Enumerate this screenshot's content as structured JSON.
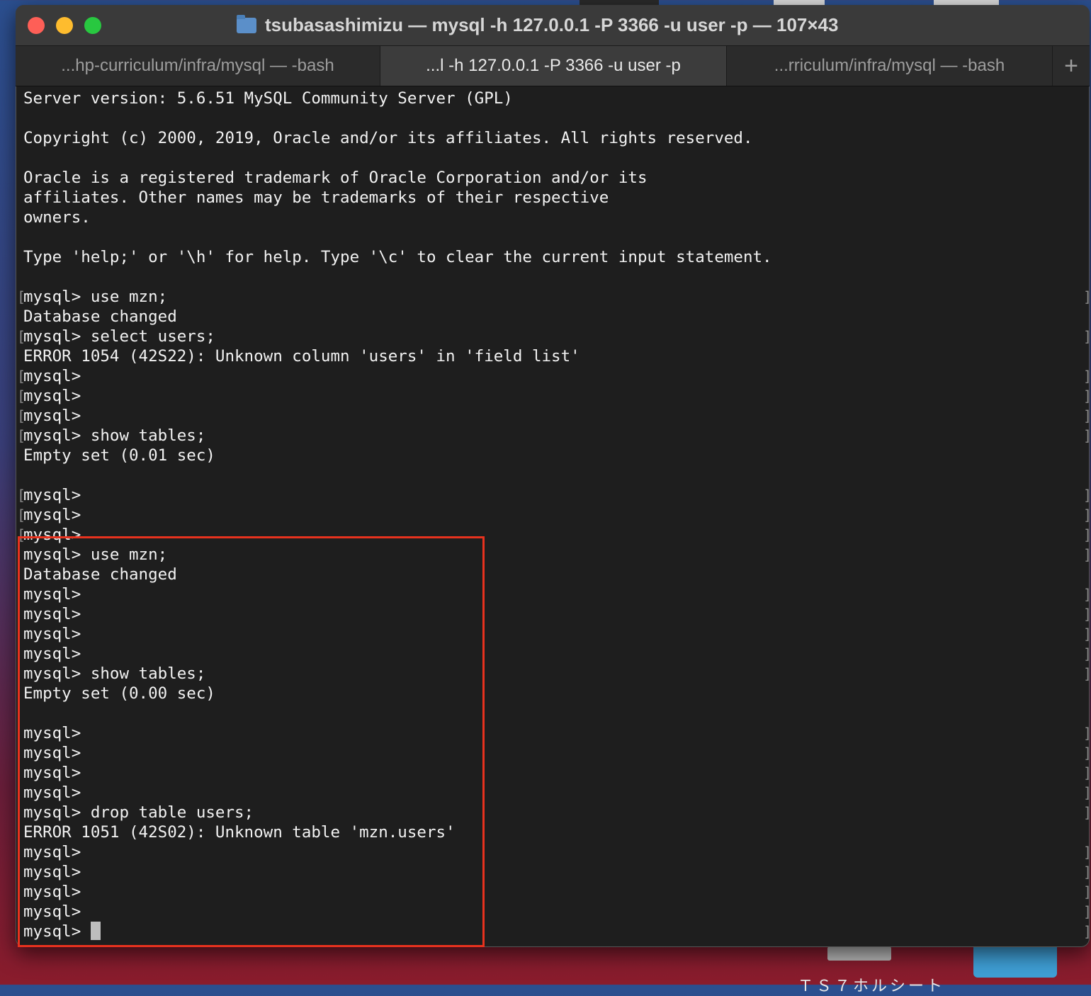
{
  "window": {
    "title": "tsubasashimizu — mysql -h 127.0.0.1 -P 3366 -u user -p — 107×43"
  },
  "tabs": [
    {
      "label": "...hp-curriculum/infra/mysql — -bash",
      "active": false
    },
    {
      "label": "...l -h 127.0.0.1 -P 3366 -u user -p",
      "active": true
    },
    {
      "label": "...rriculum/infra/mysql — -bash",
      "active": false
    }
  ],
  "new_tab_label": "+",
  "desktop": {
    "label": "ＴＳ７ホルシート"
  },
  "terminal": {
    "lines": [
      {
        "text": "Server version: 5.6.51 MySQL Community Server (GPL)",
        "prompt": false
      },
      {
        "text": "",
        "prompt": false
      },
      {
        "text": "Copyright (c) 2000, 2019, Oracle and/or its affiliates. All rights reserved.",
        "prompt": false
      },
      {
        "text": "",
        "prompt": false
      },
      {
        "text": "Oracle is a registered trademark of Oracle Corporation and/or its",
        "prompt": false
      },
      {
        "text": "affiliates. Other names may be trademarks of their respective",
        "prompt": false
      },
      {
        "text": "owners.",
        "prompt": false
      },
      {
        "text": "",
        "prompt": false
      },
      {
        "text": "Type 'help;' or '\\h' for help. Type '\\c' to clear the current input statement.",
        "prompt": false
      },
      {
        "text": "",
        "prompt": false
      },
      {
        "text": "mysql> use mzn;",
        "prompt": true,
        "marked": true
      },
      {
        "text": "Database changed",
        "prompt": false
      },
      {
        "text": "mysql> select users;",
        "prompt": true,
        "marked": true
      },
      {
        "text": "ERROR 1054 (42S22): Unknown column 'users' in 'field list'",
        "prompt": false
      },
      {
        "text": "mysql>",
        "prompt": true,
        "marked": true
      },
      {
        "text": "mysql>",
        "prompt": true,
        "marked": true
      },
      {
        "text": "mysql>",
        "prompt": true,
        "marked": true
      },
      {
        "text": "mysql> show tables;",
        "prompt": true,
        "marked": true
      },
      {
        "text": "Empty set (0.01 sec)",
        "prompt": false
      },
      {
        "text": "",
        "prompt": false
      },
      {
        "text": "mysql>",
        "prompt": true,
        "marked": true
      },
      {
        "text": "mysql>",
        "prompt": true,
        "marked": true
      },
      {
        "text": "mysql>",
        "prompt": true,
        "marked": true
      },
      {
        "text": "mysql> use mzn;",
        "prompt": true,
        "marked": false
      },
      {
        "text": "Database changed",
        "prompt": false
      },
      {
        "text": "mysql>",
        "prompt": true,
        "marked": false
      },
      {
        "text": "mysql>",
        "prompt": true,
        "marked": false
      },
      {
        "text": "mysql>",
        "prompt": true,
        "marked": false
      },
      {
        "text": "mysql>",
        "prompt": true,
        "marked": false
      },
      {
        "text": "mysql> show tables;",
        "prompt": true,
        "marked": false
      },
      {
        "text": "Empty set (0.00 sec)",
        "prompt": false
      },
      {
        "text": "",
        "prompt": false
      },
      {
        "text": "mysql>",
        "prompt": true,
        "marked": false
      },
      {
        "text": "mysql>",
        "prompt": true,
        "marked": false
      },
      {
        "text": "mysql>",
        "prompt": true,
        "marked": false
      },
      {
        "text": "mysql>",
        "prompt": true,
        "marked": false
      },
      {
        "text": "mysql> drop table users;",
        "prompt": true,
        "marked": false
      },
      {
        "text": "ERROR 1051 (42S02): Unknown table 'mzn.users'",
        "prompt": false
      },
      {
        "text": "mysql>",
        "prompt": true,
        "marked": false
      },
      {
        "text": "mysql>",
        "prompt": true,
        "marked": false
      },
      {
        "text": "mysql>",
        "prompt": true,
        "marked": false
      },
      {
        "text": "mysql>",
        "prompt": true,
        "marked": false
      },
      {
        "text": "mysql> ",
        "prompt": true,
        "marked": false,
        "cursor": true
      }
    ]
  },
  "colors": {
    "terminal_bg": "#1e1e1e",
    "terminal_fg": "#f2f2f2",
    "highlight": "#e8321e"
  }
}
